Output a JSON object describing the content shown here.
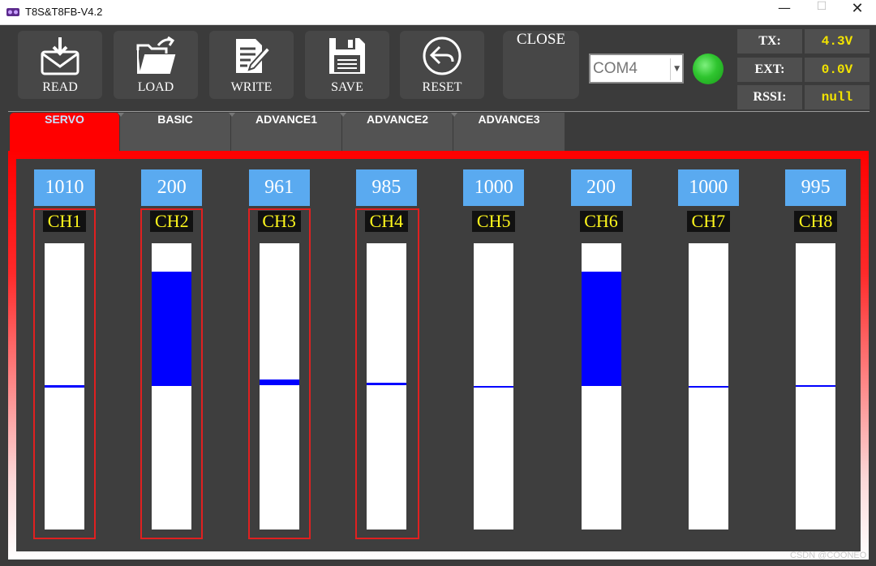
{
  "window": {
    "title": "T8S&T8FB-V4.2",
    "min_glyph": "—",
    "max_glyph": "☐",
    "close_glyph": "✕"
  },
  "toolbar": {
    "buttons": [
      {
        "label": "READ",
        "icon": "mail-download-icon"
      },
      {
        "label": "LOAD",
        "icon": "folder-open-icon"
      },
      {
        "label": "WRITE",
        "icon": "document-edit-icon"
      },
      {
        "label": "SAVE",
        "icon": "floppy-save-icon"
      },
      {
        "label": "RESET",
        "icon": "undo-arrow-icon"
      }
    ],
    "close_label": "CLOSE",
    "port": {
      "value": "COM4"
    }
  },
  "status": {
    "led_color": "#2fc52f",
    "rows": [
      {
        "label": "TX:",
        "value": "4.3V"
      },
      {
        "label": "EXT:",
        "value": "0.0V"
      },
      {
        "label": "RSSI:",
        "value": "null"
      }
    ]
  },
  "tabs": [
    {
      "label": "SERVO",
      "active": true
    },
    {
      "label": "BASIC",
      "active": false
    },
    {
      "label": "ADVANCE1",
      "active": false
    },
    {
      "label": "ADVANCE2",
      "active": false
    },
    {
      "label": "ADVANCE3",
      "active": false
    }
  ],
  "channels": [
    {
      "label": "CH1",
      "value": "1010",
      "highlighted": true,
      "fill_from": 0.497,
      "fill_to": 0.503
    },
    {
      "label": "CH2",
      "value": "200",
      "highlighted": true,
      "fill_from": 0.1,
      "fill_to": 0.5
    },
    {
      "label": "CH3",
      "value": "961",
      "highlighted": true,
      "fill_from": 0.475,
      "fill_to": 0.497
    },
    {
      "label": "CH4",
      "value": "985",
      "highlighted": true,
      "fill_from": 0.487,
      "fill_to": 0.497
    },
    {
      "label": "CH5",
      "value": "1000",
      "highlighted": false,
      "fill_from": 0.499,
      "fill_to": 0.501
    },
    {
      "label": "CH6",
      "value": "200",
      "highlighted": false,
      "fill_from": 0.1,
      "fill_to": 0.5
    },
    {
      "label": "CH7",
      "value": "1000",
      "highlighted": false,
      "fill_from": 0.499,
      "fill_to": 0.501
    },
    {
      "label": "CH8",
      "value": "995",
      "highlighted": false,
      "fill_from": 0.497,
      "fill_to": 0.502
    }
  ],
  "colors": {
    "accent_red": "#ff0000",
    "value_box": "#5aaaf0",
    "channel_label_text": "#fff71c",
    "fill_blue": "#0000ff",
    "status_value_text": "#f2e300"
  },
  "watermark": "CSDN @COONEO"
}
